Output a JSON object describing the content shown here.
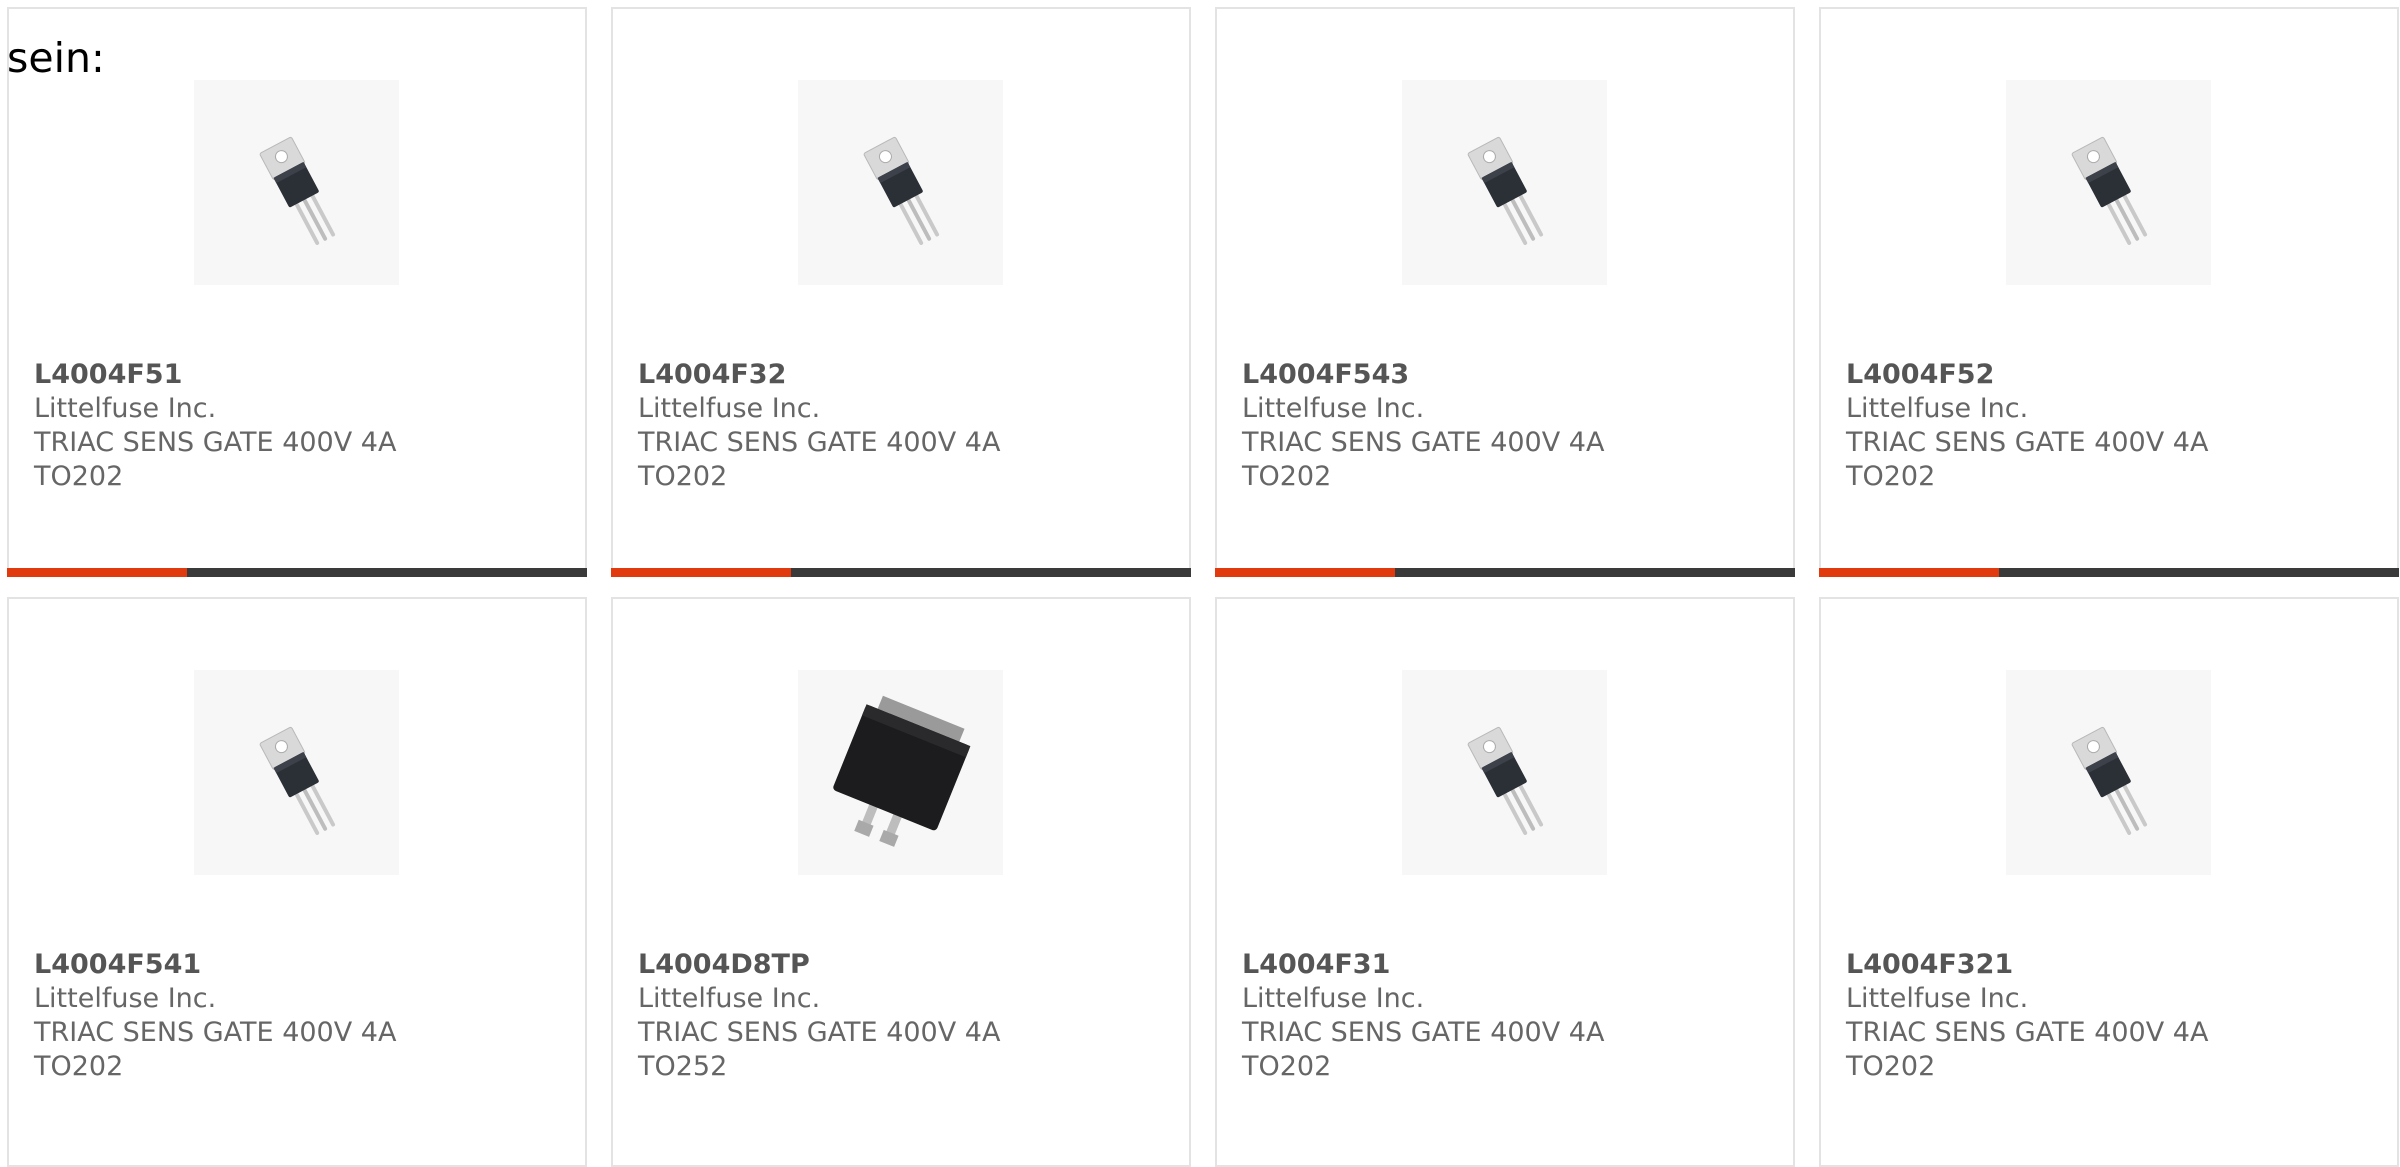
{
  "intro_text": "sein:",
  "colors": {
    "accent": "#e03a0e",
    "bar": "#3a3a3a",
    "border": "#e3e3e3",
    "text": "#666666"
  },
  "products": [
    {
      "part": "L4004F51",
      "maker": "Littelfuse Inc.",
      "desc": "TRIAC SENS GATE 400V 4A",
      "pkg": "TO202",
      "icon": "to202-package-icon",
      "progress": 0.31
    },
    {
      "part": "L4004F32",
      "maker": "Littelfuse Inc.",
      "desc": "TRIAC SENS GATE 400V 4A",
      "pkg": "TO202",
      "icon": "to202-package-icon",
      "progress": 0.31
    },
    {
      "part": "L4004F543",
      "maker": "Littelfuse Inc.",
      "desc": "TRIAC SENS GATE 400V 4A",
      "pkg": "TO202",
      "icon": "to202-package-icon",
      "progress": 0.31
    },
    {
      "part": "L4004F52",
      "maker": "Littelfuse Inc.",
      "desc": "TRIAC SENS GATE 400V 4A",
      "pkg": "TO202",
      "icon": "to202-package-icon",
      "progress": 0.31
    },
    {
      "part": "L4004F541",
      "maker": "Littelfuse Inc.",
      "desc": "TRIAC SENS GATE 400V 4A",
      "pkg": "TO202",
      "icon": "to202-package-icon"
    },
    {
      "part": "L4004D8TP",
      "maker": "Littelfuse Inc.",
      "desc": "TRIAC SENS GATE 400V 4A",
      "pkg": "TO252",
      "icon": "to252-package-icon"
    },
    {
      "part": "L4004F31",
      "maker": "Littelfuse Inc.",
      "desc": "TRIAC SENS GATE 400V 4A",
      "pkg": "TO202",
      "icon": "to202-package-icon"
    },
    {
      "part": "L4004F321",
      "maker": "Littelfuse Inc.",
      "desc": "TRIAC SENS GATE 400V 4A",
      "pkg": "TO202",
      "icon": "to202-package-icon"
    }
  ]
}
